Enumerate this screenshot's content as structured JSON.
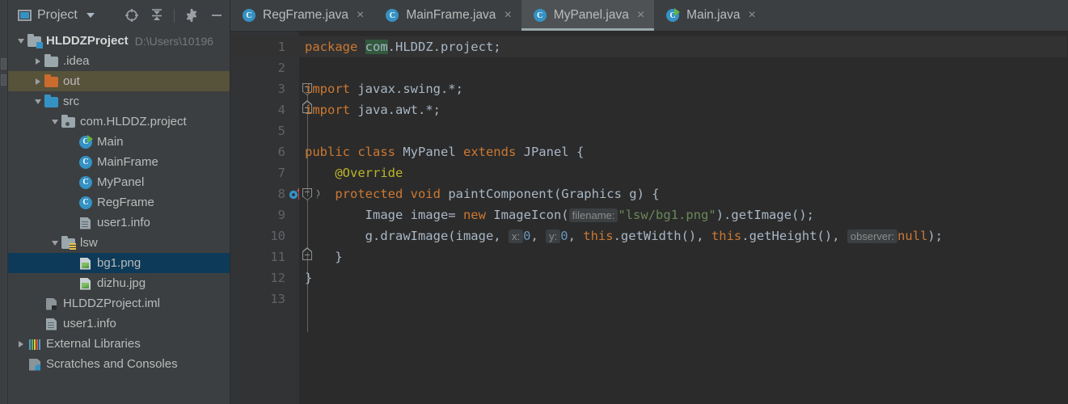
{
  "window": {
    "theme_bg": "#2b2b2b",
    "panel_bg": "#3c3f41",
    "accent": "#3592c4",
    "selection_blue": "#0d3a58",
    "selection_olive": "#57523a"
  },
  "project_panel": {
    "title": "Project",
    "title_icon": "project-window-icon",
    "dropdown_icon": "chevron-down-icon",
    "tools": [
      {
        "name": "locate-icon",
        "label": "Select Opened File"
      },
      {
        "name": "collapse-all-icon",
        "label": "Collapse All"
      },
      {
        "name": "gear-icon",
        "label": "Settings"
      },
      {
        "name": "minimize-icon",
        "label": "Hide"
      }
    ],
    "tree": [
      {
        "label": "HLDDZProject",
        "sub": "D:\\Users\\10196",
        "icon": "module-folder-icon",
        "indent": 0,
        "arrow": "down",
        "bold": true,
        "selected": "none"
      },
      {
        "label": ".idea",
        "sub": "",
        "icon": "folder-gray-icon",
        "indent": 1,
        "arrow": "right",
        "bold": false,
        "selected": "none"
      },
      {
        "label": "out",
        "sub": "",
        "icon": "folder-orange-icon",
        "indent": 1,
        "arrow": "right",
        "bold": false,
        "selected": "olive"
      },
      {
        "label": "src",
        "sub": "",
        "icon": "folder-blue-icon",
        "indent": 1,
        "arrow": "down",
        "bold": false,
        "selected": "none"
      },
      {
        "label": "com.HLDDZ.project",
        "sub": "",
        "icon": "package-icon",
        "indent": 2,
        "arrow": "down",
        "bold": false,
        "selected": "none"
      },
      {
        "label": "Main",
        "sub": "",
        "icon": "java-class-runnable-icon",
        "indent": 3,
        "arrow": "none",
        "bold": false,
        "selected": "none"
      },
      {
        "label": "MainFrame",
        "sub": "",
        "icon": "java-class-icon",
        "indent": 3,
        "arrow": "none",
        "bold": false,
        "selected": "none"
      },
      {
        "label": "MyPanel",
        "sub": "",
        "icon": "java-class-icon",
        "indent": 3,
        "arrow": "none",
        "bold": false,
        "selected": "none"
      },
      {
        "label": "RegFrame",
        "sub": "",
        "icon": "java-class-icon",
        "indent": 3,
        "arrow": "none",
        "bold": false,
        "selected": "none"
      },
      {
        "label": "user1.info",
        "sub": "",
        "icon": "file-icon",
        "indent": 3,
        "arrow": "none",
        "bold": false,
        "selected": "none"
      },
      {
        "label": "lsw",
        "sub": "",
        "icon": "folder-resource-icon",
        "indent": 2,
        "arrow": "down",
        "bold": false,
        "selected": "none"
      },
      {
        "label": "bg1.png",
        "sub": "",
        "icon": "image-file-icon",
        "indent": 3,
        "arrow": "none",
        "bold": false,
        "selected": "blue"
      },
      {
        "label": "dizhu.jpg",
        "sub": "",
        "icon": "image-file-icon",
        "indent": 3,
        "arrow": "none",
        "bold": false,
        "selected": "none"
      },
      {
        "label": "HLDDZProject.iml",
        "sub": "",
        "icon": "iml-file-icon",
        "indent": 1,
        "arrow": "none",
        "bold": false,
        "selected": "none"
      },
      {
        "label": "user1.info",
        "sub": "",
        "icon": "file-icon",
        "indent": 1,
        "arrow": "none",
        "bold": false,
        "selected": "none"
      },
      {
        "label": "External Libraries",
        "sub": "",
        "icon": "library-icon",
        "indent": 0,
        "arrow": "right",
        "bold": false,
        "selected": "none"
      },
      {
        "label": "Scratches and Consoles",
        "sub": "",
        "icon": "scratches-icon",
        "indent": 0,
        "arrow": "none",
        "bold": false,
        "selected": "none"
      }
    ]
  },
  "editor": {
    "tabs": [
      {
        "label": "RegFrame.java",
        "icon": "java-class-icon",
        "active": false,
        "close_glyph": "×"
      },
      {
        "label": "MainFrame.java",
        "icon": "java-class-icon",
        "active": false,
        "close_glyph": "×"
      },
      {
        "label": "MyPanel.java",
        "icon": "java-class-icon",
        "active": true,
        "close_glyph": "×"
      },
      {
        "label": "Main.java",
        "icon": "java-class-runnable-icon",
        "active": false,
        "close_glyph": "×"
      }
    ],
    "line_numbers": [
      "1",
      "2",
      "3",
      "4",
      "5",
      "6",
      "7",
      "8",
      "9",
      "10",
      "11",
      "12",
      "13"
    ],
    "current_line": 1,
    "gutter_markers": {
      "line": 8,
      "override_icon": "override-method-icon",
      "annotation_icon": "annotation-at-icon",
      "at_glyph": "@"
    },
    "code": [
      {
        "n": "1",
        "segments": [
          {
            "t": "package ",
            "c": "kw"
          },
          {
            "t": "com",
            "c": "sel"
          },
          {
            "t": ".HLDDZ.project;",
            "c": "plain"
          }
        ]
      },
      {
        "n": "2",
        "segments": []
      },
      {
        "n": "3",
        "segments": [
          {
            "t": "import ",
            "c": "kw"
          },
          {
            "t": "javax.swing.*;",
            "c": "plain"
          }
        ]
      },
      {
        "n": "4",
        "segments": [
          {
            "t": "import ",
            "c": "kw"
          },
          {
            "t": "java.awt.*;",
            "c": "plain"
          }
        ]
      },
      {
        "n": "5",
        "segments": []
      },
      {
        "n": "6",
        "segments": [
          {
            "t": "public class ",
            "c": "kw"
          },
          {
            "t": "MyPanel ",
            "c": "plain"
          },
          {
            "t": "extends ",
            "c": "kw"
          },
          {
            "t": "JPanel {",
            "c": "plain"
          }
        ]
      },
      {
        "n": "7",
        "segments": [
          {
            "t": "    ",
            "c": "plain"
          },
          {
            "t": "@Override",
            "c": "anno"
          }
        ]
      },
      {
        "n": "8",
        "segments": [
          {
            "t": "    ",
            "c": "plain"
          },
          {
            "t": "protected void ",
            "c": "kw"
          },
          {
            "t": "paintComponent(Graphics g) {",
            "c": "plain"
          }
        ]
      },
      {
        "n": "9",
        "segments": [
          {
            "t": "        Image image= ",
            "c": "plain"
          },
          {
            "t": "new ",
            "c": "kw"
          },
          {
            "t": "ImageIcon(",
            "c": "plain"
          },
          {
            "t": "filename:",
            "c": "hint"
          },
          {
            "t": "\"lsw/bg1.png\"",
            "c": "str"
          },
          {
            "t": ").getImage();",
            "c": "plain"
          }
        ]
      },
      {
        "n": "10",
        "segments": [
          {
            "t": "        g.drawImage(image, ",
            "c": "plain"
          },
          {
            "t": "x:",
            "c": "hint"
          },
          {
            "t": "0",
            "c": "num"
          },
          {
            "t": ", ",
            "c": "plain"
          },
          {
            "t": "y:",
            "c": "hint"
          },
          {
            "t": "0",
            "c": "num"
          },
          {
            "t": ", ",
            "c": "plain"
          },
          {
            "t": "this",
            "c": "kw"
          },
          {
            "t": ".getWidth(), ",
            "c": "plain"
          },
          {
            "t": "this",
            "c": "kw"
          },
          {
            "t": ".getHeight(), ",
            "c": "plain"
          },
          {
            "t": "observer:",
            "c": "hint"
          },
          {
            "t": "null",
            "c": "kw"
          },
          {
            "t": ");",
            "c": "plain"
          }
        ]
      },
      {
        "n": "11",
        "segments": [
          {
            "t": "    }",
            "c": "plain"
          }
        ]
      },
      {
        "n": "12",
        "segments": [
          {
            "t": "}",
            "c": "plain"
          }
        ]
      },
      {
        "n": "13",
        "segments": []
      }
    ],
    "fold_markers": [
      {
        "line": 3,
        "kind": "down"
      },
      {
        "line": 4,
        "kind": "up"
      },
      {
        "line": 8,
        "kind": "down"
      },
      {
        "line": 11,
        "kind": "up"
      }
    ]
  }
}
